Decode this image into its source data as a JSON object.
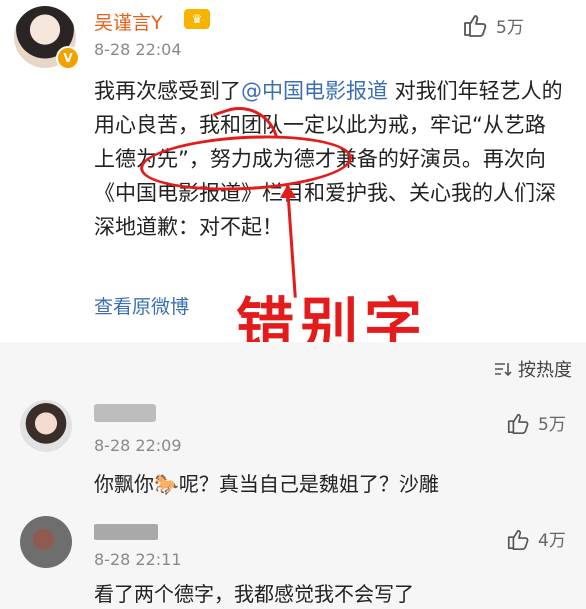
{
  "post": {
    "author": "吴谨言Y",
    "time": "8-28 22:04",
    "likes": "5万",
    "text_before_mention": "我再次感受到了",
    "mention": "@中国电影报道",
    "text_after_mention": " 对我们年轻艺人的用心良苦，我和团队一定以此为戒，牢记“从艺路上德为先”，努力成为德才兼备的好演员。再次向《中国电影报道》栏目和爱护我、关心我的人们深深地道歉：对不起！",
    "view_original": "查看原微博",
    "overlay_label": "错别字",
    "accent_color": "#e8611a",
    "link_color": "#3b6fb3",
    "annotation_color": "#e31b1b"
  },
  "comments_header": {
    "sort_label": "按热度"
  },
  "comments": [
    {
      "time": "8-28 22:09",
      "likes": "5万",
      "text_a": "你飘你",
      "emoji": "🐎",
      "text_b": "呢？真当自己是魏姐了？沙雕"
    },
    {
      "time": "8-28 22:11",
      "likes": "4万",
      "text": "看了两个德字，我都感觉我不会写了"
    }
  ]
}
